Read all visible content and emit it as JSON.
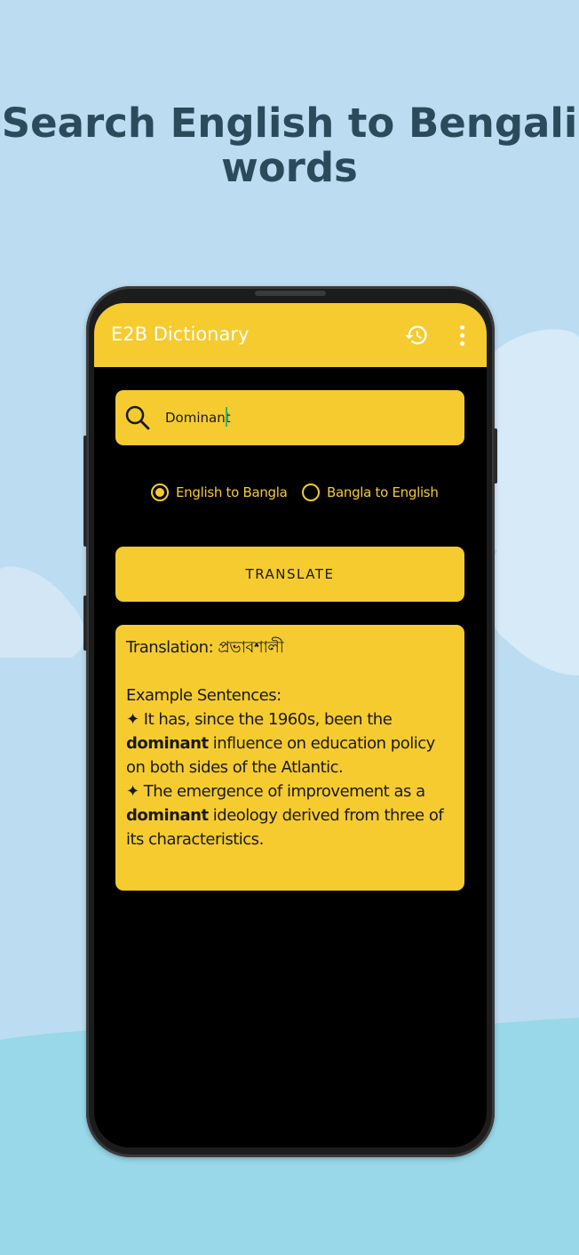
{
  "headline": {
    "line1": "Search English to Bengali",
    "line2": "words"
  },
  "appbar": {
    "title": "E2B Dictionary",
    "history_icon": "history-icon",
    "menu_icon": "more-vert-icon"
  },
  "search": {
    "value": "Dominant",
    "icon": "search-icon"
  },
  "direction": {
    "options": [
      {
        "label": "English to Bangla",
        "selected": true
      },
      {
        "label": "Bangla to English",
        "selected": false
      }
    ]
  },
  "translate_button": {
    "label": "TRANSLATE"
  },
  "result": {
    "translation_label": "Translation: প্রভাবশালী",
    "examples_heading": "Example Sentences:",
    "sentences": [
      {
        "prefix": "✦ It has, since the 1960s, been the ",
        "bold": "dominant",
        "suffix": " influence on education policy on both sides of the Atlantic."
      },
      {
        "prefix": "✦ The emergence of improvement as a ",
        "bold": "dominant",
        "suffix": " ideology derived from three of its characteristics."
      }
    ]
  },
  "colors": {
    "accent": "#f5cb30",
    "background": "#bcdcf1",
    "headline": "#2b4b5c",
    "screen": "#000000"
  }
}
